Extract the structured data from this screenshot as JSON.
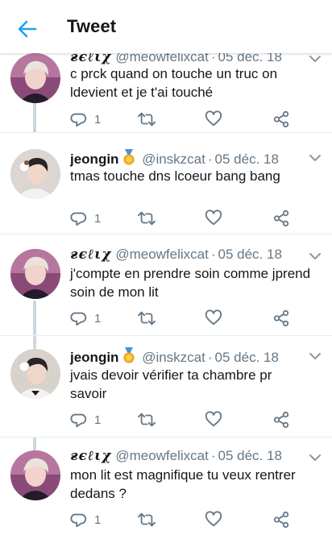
{
  "header": {
    "title": "Tweet"
  },
  "colors": {
    "accent": "#1da1f2",
    "muted": "#657786",
    "line": "#ccd6dd"
  },
  "tweets": [
    {
      "name": "ғєℓιχ",
      "fancy": true,
      "medal": false,
      "handle": "@meowfelixcat",
      "dot": "·",
      "date": "05 déc. 18",
      "text": "c prck quand on touche un truc on ldevient et je t'ai touché",
      "replies": "1"
    },
    {
      "name": "jeongin",
      "fancy": false,
      "medal": true,
      "medal_icon": "medal-icon",
      "handle": "@inskzcat",
      "dot": "·",
      "date": "05 déc. 18",
      "text": "tmas touche dns lcoeur bang bang",
      "replies": "1"
    },
    {
      "name": "ғєℓιχ",
      "fancy": true,
      "medal": false,
      "handle": "@meowfelixcat",
      "dot": "·",
      "date": "05 déc. 18",
      "text": "j'compte en prendre soin comme jprend soin de mon lit",
      "replies": "1"
    },
    {
      "name": "jeongin",
      "fancy": false,
      "medal": true,
      "medal_icon": "medal-icon",
      "handle": "@inskzcat",
      "dot": "·",
      "date": "05 déc. 18",
      "text": "jvais devoir vérifier ta chambre pr savoir",
      "replies": "1"
    },
    {
      "name": "ғєℓιχ",
      "fancy": true,
      "medal": false,
      "handle": "@meowfelixcat",
      "dot": "·",
      "date": "05 déc. 18",
      "text": "mon lit est magnifique tu veux rentrer dedans ?",
      "replies": "1"
    }
  ]
}
